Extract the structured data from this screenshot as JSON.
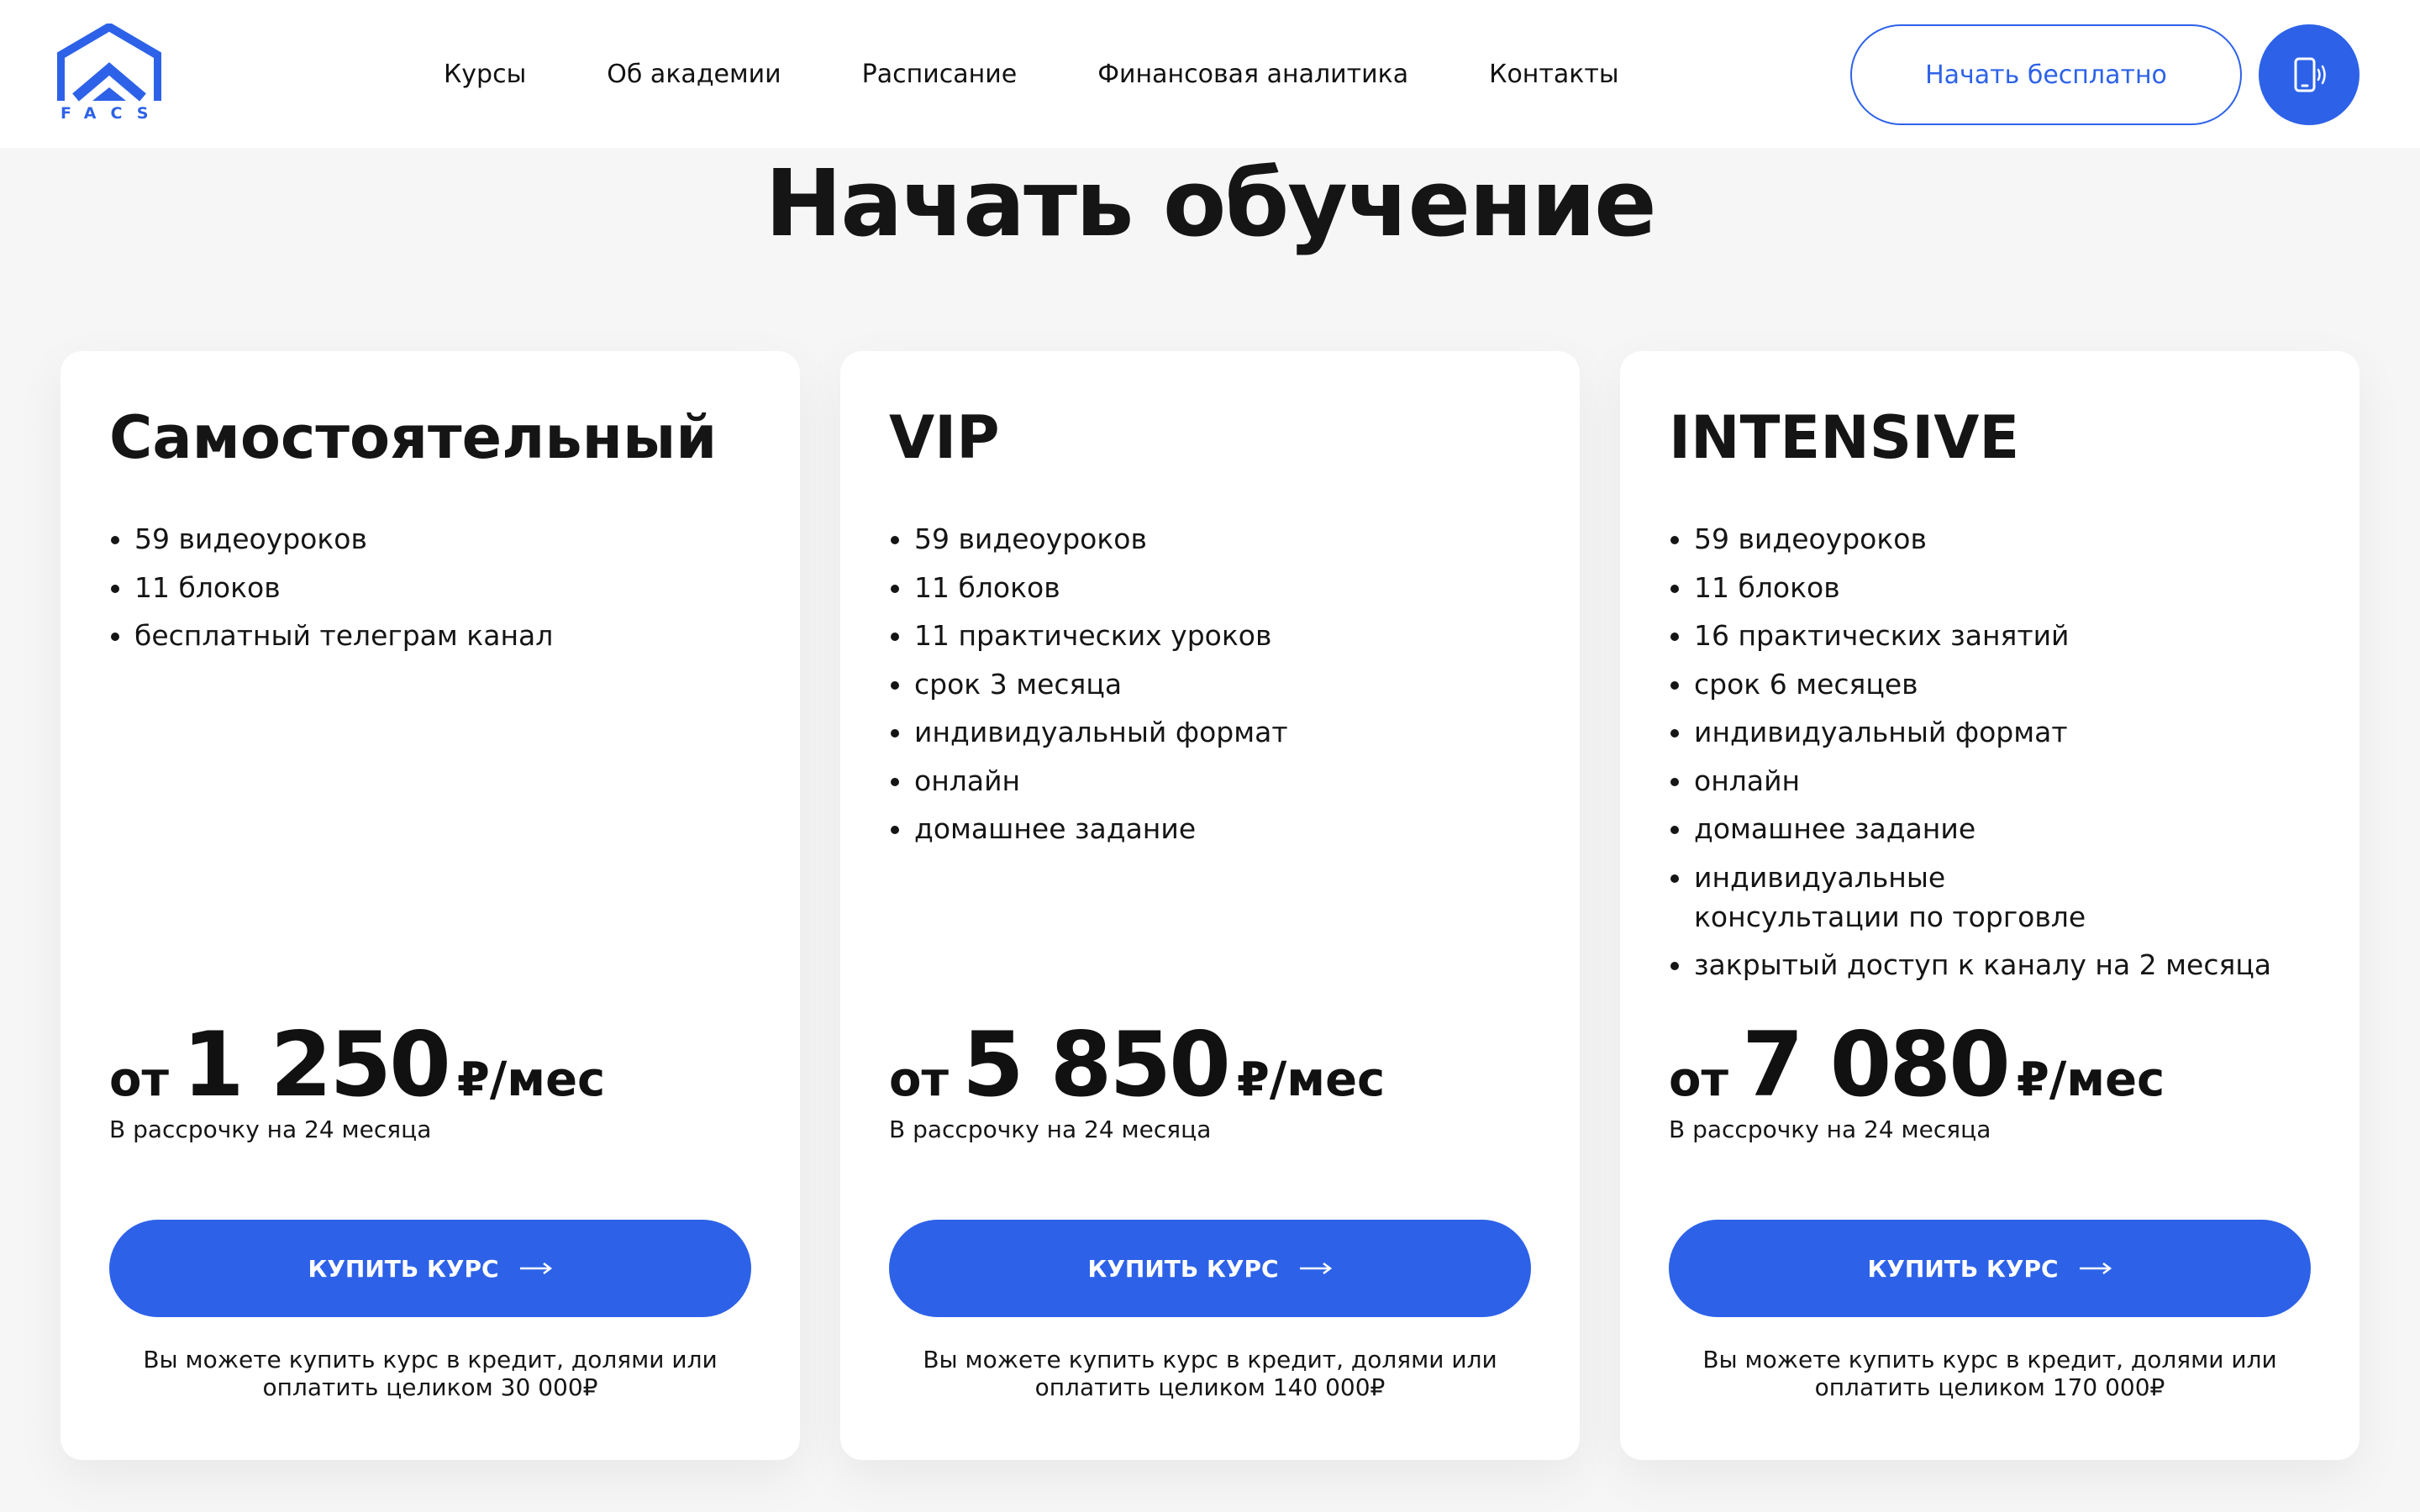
{
  "header": {
    "logo_text": "FACS",
    "nav": [
      "Курсы",
      "Об академии",
      "Расписание",
      "Финансовая аналитика",
      "Контакты"
    ],
    "cta_label": "Начать бесплатно",
    "phone_icon": "phone-icon"
  },
  "page": {
    "title": "Начать обучение"
  },
  "colors": {
    "accent": "#2d62e8",
    "background": "#f6f6f6",
    "card": "#ffffff",
    "text": "#151515"
  },
  "cards": [
    {
      "name": "Самостоятельный",
      "features": [
        "59 видеоуроков",
        "11 блоков",
        "бесплатный телеграм канал"
      ],
      "price_prefix": "от",
      "price_value": "1 250",
      "price_suffix": "₽/мес",
      "installment": "В рассрочку на 24 месяца",
      "button_label": "КУПИТЬ КУРС",
      "note_line1": "Вы можете купить курс в кредит, долями или",
      "note_line2": "оплатить целиком 30 000₽"
    },
    {
      "name": "VIP",
      "features": [
        "59 видеоуроков",
        "11 блоков",
        "11 практических уроков",
        "срок 3 месяца",
        "индивидуальный формат",
        "онлайн",
        "домашнее задание"
      ],
      "price_prefix": "от",
      "price_value": "5 850",
      "price_suffix": "₽/мес",
      "installment": "В рассрочку на 24 месяца",
      "button_label": "КУПИТЬ КУРС",
      "note_line1": "Вы можете купить курс в кредит, долями или",
      "note_line2": "оплатить целиком 140 000₽"
    },
    {
      "name": "INTENSIVE",
      "features": [
        "59 видеоуроков",
        "11 блоков",
        "16 практических занятий",
        "срок 6 месяцев",
        "индивидуальный формат",
        "онлайн",
        "домашнее задание",
        "индивидуальные консультации по торговле",
        "закрытый доступ к каналу на 2 месяца"
      ],
      "price_prefix": "от",
      "price_value": "7 080",
      "price_suffix": "₽/мес",
      "installment": "В рассрочку на 24 месяца",
      "button_label": "КУПИТЬ КУРС",
      "note_line1": "Вы можете купить курс в кредит, долями или",
      "note_line2": "оплатить целиком 170 000₽"
    }
  ]
}
